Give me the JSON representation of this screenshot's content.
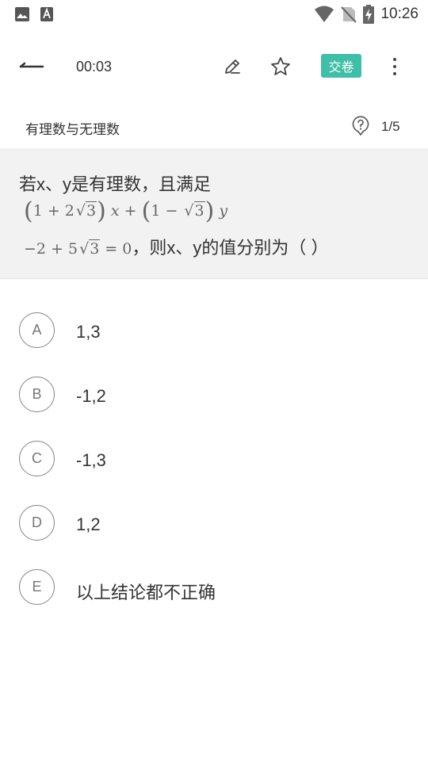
{
  "status_bar": {
    "time": "10:26",
    "left_icons": [
      "image-icon",
      "font-app-icon"
    ],
    "right_icons": [
      "wifi-icon",
      "no-sim-icon",
      "battery-charging-icon"
    ]
  },
  "toolbar": {
    "timer": "00:03",
    "submit_label": "交卷",
    "accent_color": "#3fbfa8"
  },
  "topic": {
    "title": "有理数与无理数",
    "page": "1/5"
  },
  "question": {
    "line1": "若x、y是有理数，且满足",
    "line3_text": "，则x、y的值分别为（ ）"
  },
  "options": [
    {
      "letter": "A",
      "text": "1,3"
    },
    {
      "letter": "B",
      "text": "-1,2"
    },
    {
      "letter": "C",
      "text": "-1,3"
    },
    {
      "letter": "D",
      "text": "1,2"
    },
    {
      "letter": "E",
      "text": "以上结论都不正确"
    }
  ]
}
